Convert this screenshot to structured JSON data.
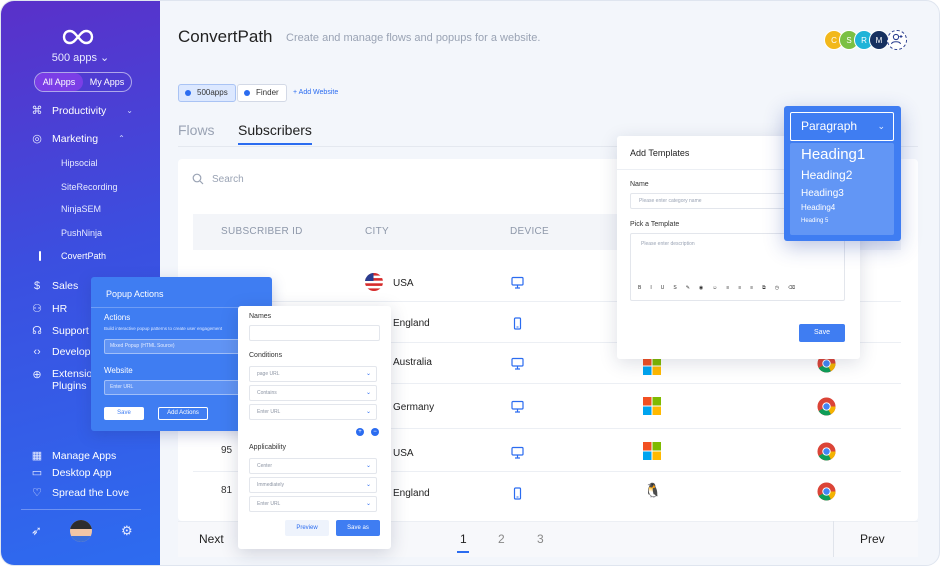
{
  "sidebar": {
    "org": "500 apps",
    "segments": [
      "All Apps",
      "My Apps"
    ],
    "nav": {
      "productivity": "Productivity",
      "marketing": "Marketing",
      "sales": "Sales",
      "hr": "HR",
      "support": "Support",
      "develop": "Develop",
      "extensions": "Extensions",
      "plugins": "Plugins"
    },
    "marketing_apps": [
      "Hipsocial",
      "SiteRecording",
      "NinjaSEM",
      "PushNinja",
      "CovertPath"
    ],
    "bottom": {
      "manage_apps": "Manage Apps",
      "desktop_app": "Desktop App",
      "spread_love": "Spread the Love"
    }
  },
  "header": {
    "title": "ConvertPath",
    "subtitle": "Create and manage flows and popups for a website.",
    "avatars": [
      {
        "letter": "C",
        "color": "#f2b81c"
      },
      {
        "letter": "S",
        "color": "#7bc043"
      },
      {
        "letter": "R",
        "color": "#1fb4d8"
      },
      {
        "letter": "M",
        "color": "#16305f"
      }
    ]
  },
  "websites": {
    "chips": [
      "500apps",
      "Finder"
    ],
    "add": "+ Add Website"
  },
  "tabs": {
    "flows": "Flows",
    "subscribers": "Subscribers"
  },
  "table": {
    "search_placeholder": "Search",
    "headers": [
      "SUBSCRIBER ID",
      "CITY",
      "DEVICE"
    ],
    "rows": [
      {
        "id": "",
        "city": "USA",
        "device": "desktop"
      },
      {
        "id": "",
        "city": "England",
        "device": "mobile"
      },
      {
        "id": "",
        "city": "Australia",
        "device": "desktop"
      },
      {
        "id": "",
        "city": "Germany",
        "device": "desktop"
      },
      {
        "id": "95",
        "city": "USA",
        "device": "desktop"
      },
      {
        "id": "81",
        "city": "England",
        "device": "mobile"
      }
    ]
  },
  "pagination": {
    "next": "Next",
    "prev": "Prev",
    "pages": [
      "1",
      "2",
      "3"
    ],
    "current": "1"
  },
  "popup_actions": {
    "title": "Popup Actions",
    "actions_label": "Actions",
    "actions_desc": "Build interactive popup patterns to create user engagement",
    "actions_value": "Mixed Popup (HTML Source)",
    "website_label": "Website",
    "website_placeholder": "Enter URL",
    "save": "Save",
    "add_actions": "Add Actions"
  },
  "conditions_panel": {
    "names_label": "Names",
    "conditions_label": "Conditions",
    "conditions": [
      "page URL",
      "Contains",
      "Enter URL"
    ],
    "applicability_label": "Applicability",
    "applicability": [
      "Center",
      "Immediately",
      "Enter URL"
    ],
    "preview": "Preview",
    "save_as": "Save as"
  },
  "templates_panel": {
    "title": "Add Templates",
    "name_label": "Name",
    "name_placeholder": "Please enter category name",
    "pick_label": "Pick a Template",
    "desc_placeholder": "Please enter description",
    "toolbar": [
      "B",
      "I",
      "U",
      "S",
      "✎",
      "◉",
      "☺",
      "≡",
      "≡",
      "≡",
      "⧉",
      "◷",
      "⌫"
    ],
    "save": "Save"
  },
  "paragraph_dropdown": {
    "selected": "Paragraph",
    "options": [
      "Heading1",
      "Heading2",
      "Heading3",
      "Heading4",
      "Heading 5"
    ]
  }
}
